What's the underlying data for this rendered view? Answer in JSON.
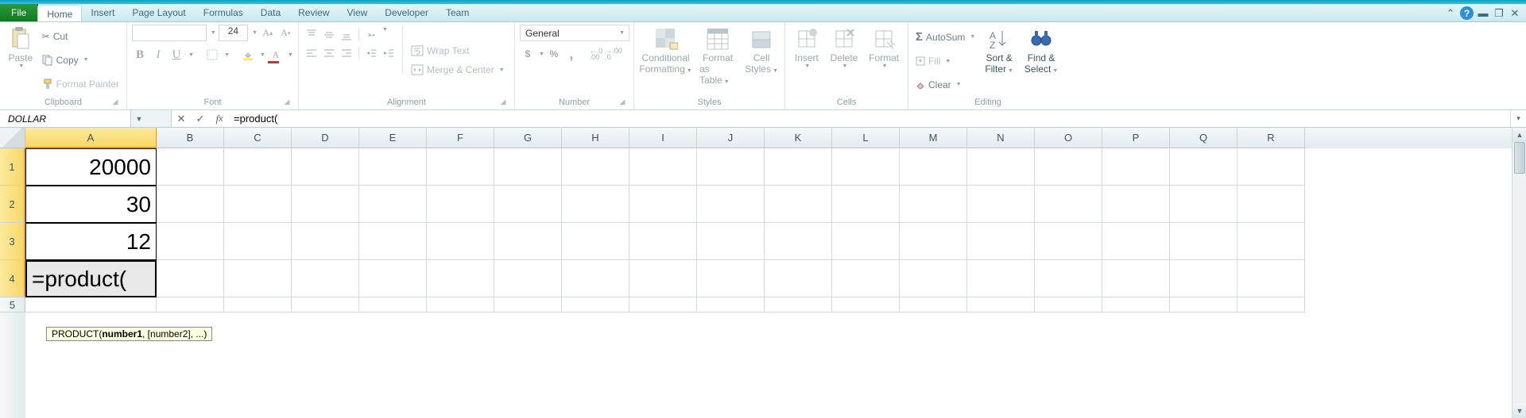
{
  "tabs": {
    "file": "File",
    "home": "Home",
    "insert": "Insert",
    "pagelayout": "Page Layout",
    "formulas": "Formulas",
    "data": "Data",
    "review": "Review",
    "view": "View",
    "developer": "Developer",
    "team": "Team"
  },
  "clipboard": {
    "paste": "Paste",
    "cut": "Cut",
    "copy": "Copy",
    "fmtpainter": "Format Painter",
    "label": "Clipboard"
  },
  "font": {
    "name": "",
    "size": "24",
    "label": "Font"
  },
  "alignment": {
    "wrap": "Wrap Text",
    "merge": "Merge & Center",
    "label": "Alignment"
  },
  "number": {
    "format": "General",
    "label": "Number"
  },
  "styles": {
    "cond": "Conditional",
    "cond2": "Formatting",
    "fmt": "Format",
    "fmt2": "as Table",
    "cell": "Cell",
    "cell2": "Styles",
    "label": "Styles"
  },
  "cellsgrp": {
    "insert": "Insert",
    "delete": "Delete",
    "format": "Format",
    "label": "Cells"
  },
  "editing": {
    "autosum": "AutoSum",
    "fill": "Fill",
    "clear": "Clear",
    "sort": "Sort &",
    "sort2": "Filter",
    "find": "Find &",
    "find2": "Select",
    "label": "Editing"
  },
  "namebox": "DOLLAR",
  "formula": "=product(",
  "cols": [
    "A",
    "B",
    "C",
    "D",
    "E",
    "F",
    "G",
    "H",
    "I",
    "J",
    "K",
    "L",
    "M",
    "N",
    "O",
    "P",
    "Q",
    "R"
  ],
  "rows": [
    "1",
    "2",
    "3",
    "4",
    "5"
  ],
  "a1": "20000",
  "a2": "30",
  "a3": "12",
  "a4": "=product(",
  "tooltip_pre": "PRODUCT(",
  "tooltip_b": "number1",
  "tooltip_post": ", [number2], ...)",
  "col_widths": {
    "A": 165,
    "other": 85
  },
  "row_heights": {
    "default": 47,
    "r5": 19
  }
}
